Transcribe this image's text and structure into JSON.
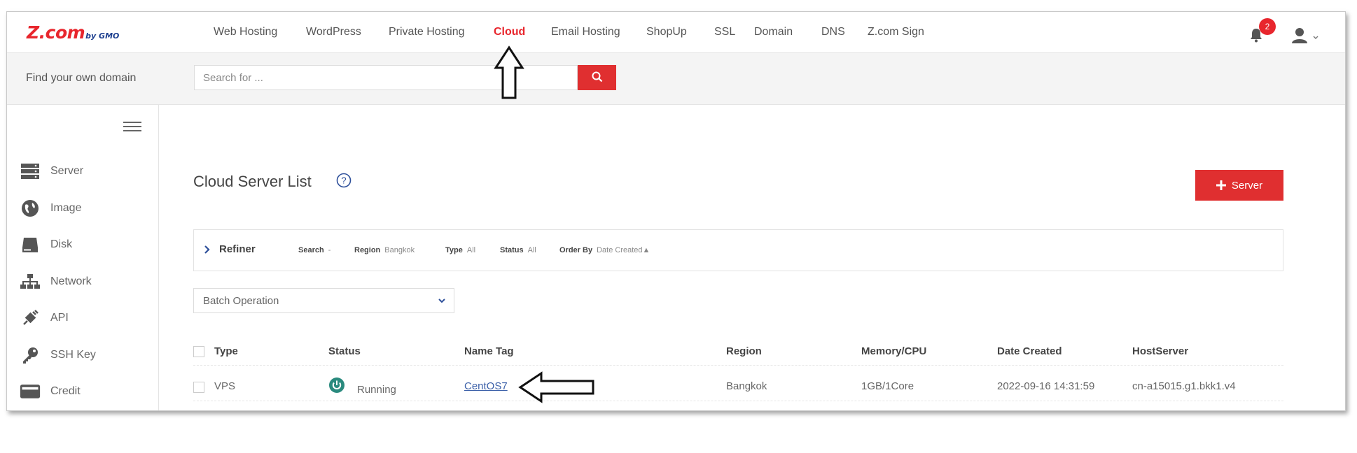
{
  "brand": {
    "logo_main": "Z.com",
    "logo_sub": "by GMO"
  },
  "nav": {
    "items": [
      {
        "label": "Web Hosting"
      },
      {
        "label": "WordPress"
      },
      {
        "label": "Private Hosting"
      },
      {
        "label": "Cloud",
        "active": true
      },
      {
        "label": "Email Hosting"
      },
      {
        "label": "ShopUp"
      },
      {
        "label": "SSL"
      },
      {
        "label": "Domain"
      },
      {
        "label": "DNS"
      },
      {
        "label": "Z.com Sign"
      }
    ],
    "notifications_count": "2"
  },
  "search": {
    "label": "Find your own domain",
    "placeholder": "Search for ..."
  },
  "sidebar": {
    "items": [
      {
        "label": "Server",
        "icon": "server-icon"
      },
      {
        "label": "Image",
        "icon": "globe-icon"
      },
      {
        "label": "Disk",
        "icon": "disk-icon"
      },
      {
        "label": "Network",
        "icon": "network-icon"
      },
      {
        "label": "API",
        "icon": "api-icon"
      },
      {
        "label": "SSH Key",
        "icon": "key-icon"
      },
      {
        "label": "Credit",
        "icon": "credit-card-icon"
      }
    ]
  },
  "main": {
    "title": "Cloud Server List",
    "add_button_label": "Server",
    "refiner": {
      "label": "Refiner",
      "search_label": "Search",
      "search_value": "-",
      "region_label": "Region",
      "region_value": "Bangkok",
      "type_label": "Type",
      "type_value": "All",
      "status_label": "Status",
      "status_value": "All",
      "order_label": "Order By",
      "order_value": "Date Created▲"
    },
    "batch_label": "Batch Operation",
    "table": {
      "headers": {
        "type": "Type",
        "status": "Status",
        "name_tag": "Name Tag",
        "region": "Region",
        "memory_cpu": "Memory/CPU",
        "date_created": "Date Created",
        "host_server": "HostServer"
      },
      "rows": [
        {
          "type": "VPS",
          "status": "Running",
          "name_tag": "CentOS7",
          "region": "Bangkok",
          "memory_cpu": "1GB/1Core",
          "date_created": "2022-09-16 14:31:59",
          "host_server": "cn-a15015.g1.bkk1.v4"
        }
      ]
    }
  },
  "colors": {
    "accent": "#e02f30",
    "brand_blue": "#1d3f8f",
    "status_running": "#2a8a7e",
    "link": "#3a5fa8"
  }
}
